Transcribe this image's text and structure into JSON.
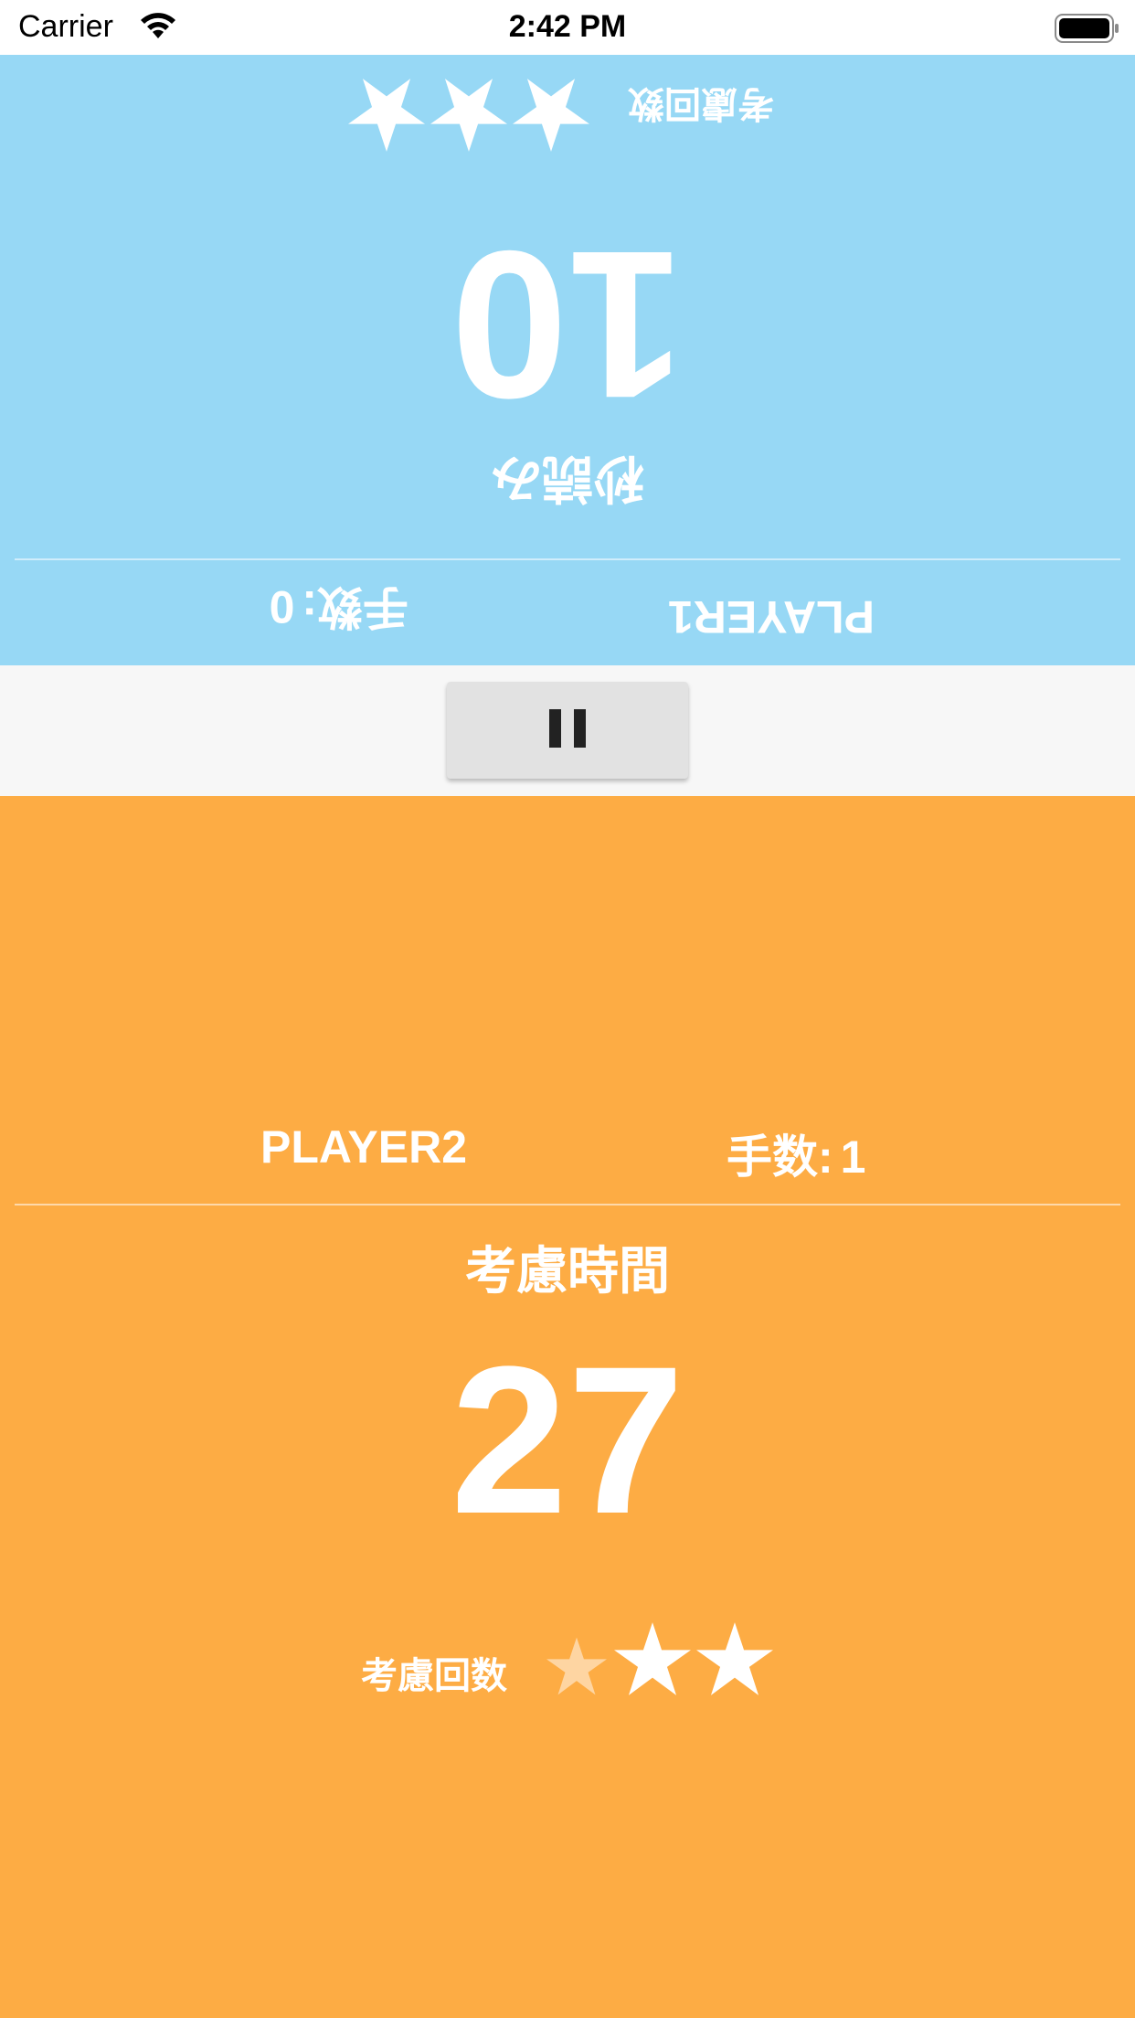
{
  "status_bar": {
    "carrier": "Carrier",
    "time": "2:42 PM",
    "wifi_icon": "wifi-icon",
    "battery_icon": "battery-full-icon"
  },
  "player1": {
    "name": "PLAYER1",
    "moves_label": "手数",
    "moves_value": "0",
    "time_label": "秒読み",
    "time_value": "10",
    "consider_label": "考慮回数",
    "stars_total": 3,
    "stars_used": 0,
    "background": "#97d8f5",
    "orientation": "upside-down"
  },
  "player2": {
    "name": "PLAYER2",
    "moves_label": "手数",
    "moves_value": "1",
    "time_label": "考慮時間",
    "time_value": "27",
    "consider_label": "考慮回数",
    "stars_total": 3,
    "stars_used": 1,
    "background": "#fdac44"
  },
  "controls": {
    "pause_icon": "pause-icon"
  }
}
